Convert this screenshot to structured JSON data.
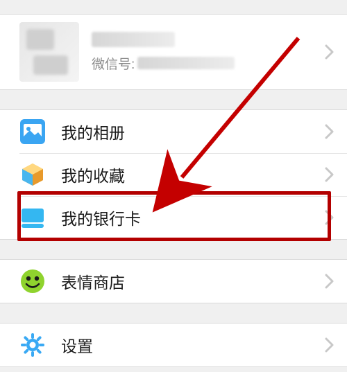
{
  "profile": {
    "wx_label": "微信号: "
  },
  "menu": {
    "album": "我的相册",
    "favorites": "我的收藏",
    "bankcard": "我的银行卡",
    "stickers": "表情商店",
    "settings": "设置"
  },
  "annotation": {
    "highlighted_item": "bankcard"
  }
}
